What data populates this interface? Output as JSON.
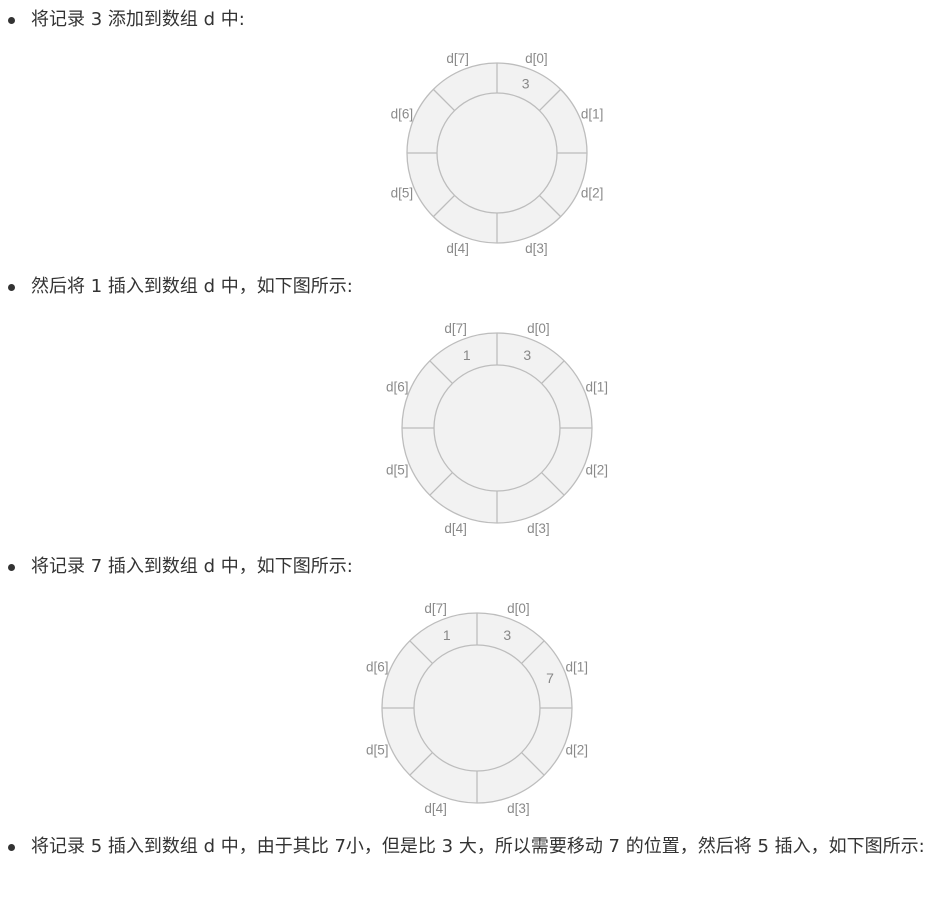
{
  "steps": [
    {
      "text": "将记录 3 添加到数组 d 中:"
    },
    {
      "text": "然后将 1 插入到数组 d 中，如下图所示:"
    },
    {
      "text": "将记录 7 插入到数组 d 中，如下图所示:"
    },
    {
      "text": "将记录 5 插入到数组 d 中，由于其比 7小，但是比 3 大，所以需要移动 7 的位置，然后将 5 插入，如下图所示:"
    }
  ],
  "labels": [
    "d[0]",
    "d[1]",
    "d[2]",
    "d[3]",
    "d[4]",
    "d[5]",
    "d[6]",
    "d[7]"
  ],
  "diagrams": [
    {
      "values": [
        "3",
        "",
        "",
        "",
        "",
        "",
        "",
        ""
      ]
    },
    {
      "values": [
        "3",
        "",
        "",
        "",
        "",
        "",
        "",
        "1"
      ]
    },
    {
      "values": [
        "3",
        "7",
        "",
        "",
        "",
        "",
        "",
        "1"
      ]
    }
  ],
  "colors": {
    "ring_fill": "#f2f2f2",
    "ring_stroke": "#bdbdbd",
    "label": "#8a8a8a"
  }
}
